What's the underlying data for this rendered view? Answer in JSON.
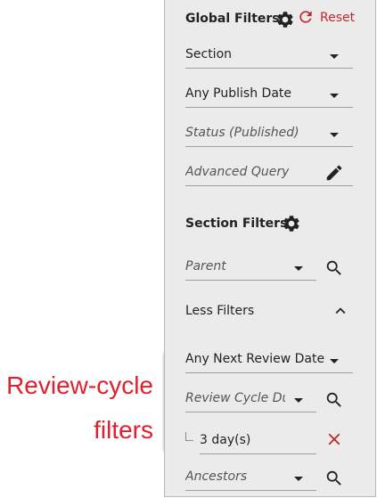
{
  "callout": {
    "line1": "Review-cycle",
    "line2": "filters",
    "color": "#e0202e"
  },
  "header": {
    "title": "Global Filters",
    "reset_label": "Reset",
    "accent": "#c2272d"
  },
  "global_filters": {
    "section": {
      "value": "Section"
    },
    "publish_date": {
      "value": "Any Publish Date"
    },
    "status": {
      "placeholder": "Status (Published)"
    },
    "advanced_query": {
      "placeholder": "Advanced Query"
    }
  },
  "section_filters": {
    "title": "Section Filters",
    "parent": {
      "placeholder": "Parent"
    }
  },
  "toggle": {
    "label": "Less Filters"
  },
  "review_filters": {
    "next_review_date": {
      "value": "Any Next Review Date"
    },
    "review_cycle_duration": {
      "placeholder": "Review Cycle Du"
    },
    "selected_value": "3 day(s)",
    "ancestors": {
      "placeholder": "Ancestors"
    }
  },
  "icons": {
    "settings": "gear-icon",
    "reset": "refresh-icon",
    "edit": "pencil-icon",
    "search": "search-icon",
    "collapse": "chevron-up-icon",
    "remove": "close-icon",
    "dropdown": "caret-down-icon"
  }
}
